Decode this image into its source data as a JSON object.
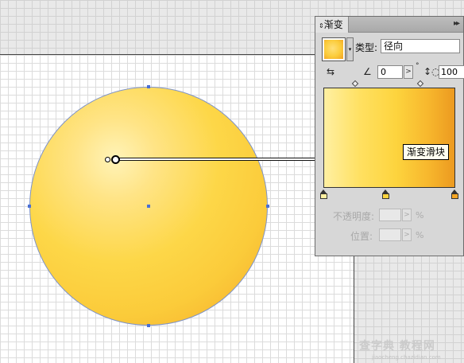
{
  "panel": {
    "tab_label": "渐变",
    "menu_glyph": "▸▸",
    "type_label": "类型:",
    "type_value": "径向",
    "angle_value": "0",
    "angle_step": ">",
    "degree_mark": "°",
    "ratio_value": "100",
    "tooltip": "渐变滑块",
    "opacity_label": "不透明度:",
    "location_label": "位置:",
    "percent": "%",
    "dim_step": ">",
    "swatch_drop": "▾",
    "gradient_colors": [
      "#fff0a2",
      "#fdd43e",
      "#ec9a20"
    ],
    "stop_colors": [
      "#fff0a2",
      "#fdd43e",
      "#f5a624"
    ]
  },
  "watermark": {
    "text": "查字典 教程网",
    "sub": "jiaocheng.chazidian.com"
  }
}
